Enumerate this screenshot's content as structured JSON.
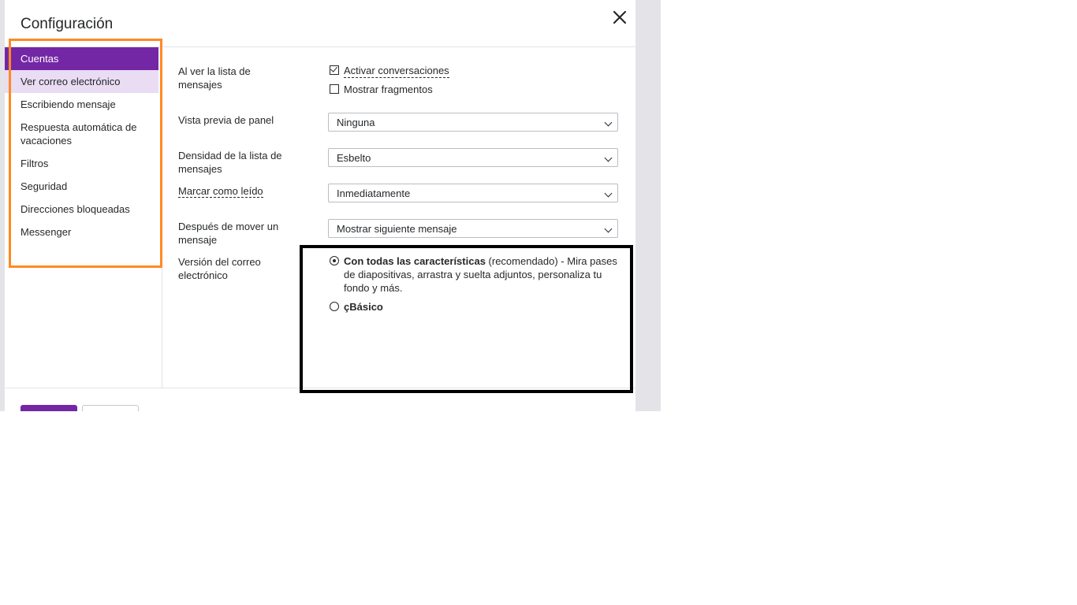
{
  "dialog": {
    "title": "Configuración"
  },
  "sidebar": {
    "items": [
      {
        "label": "Cuentas",
        "state": "active"
      },
      {
        "label": "Ver correo electrónico",
        "state": "hover"
      },
      {
        "label": "Escribiendo mensaje",
        "state": ""
      },
      {
        "label": "Respuesta automática de vacaciones",
        "state": ""
      },
      {
        "label": "Filtros",
        "state": ""
      },
      {
        "label": "Seguridad",
        "state": ""
      },
      {
        "label": "Direcciones bloqueadas",
        "state": ""
      },
      {
        "label": "Messenger",
        "state": ""
      }
    ]
  },
  "settings": {
    "message_list": {
      "label": "Al ver la lista de mensajes",
      "conversations": {
        "label": "Activar conversaciones",
        "checked": true
      },
      "snippets": {
        "label": "Mostrar fragmentos",
        "checked": false
      }
    },
    "preview_pane": {
      "label": "Vista previa de panel",
      "value": "Ninguna"
    },
    "density": {
      "label": "Densidad de la lista de mensajes",
      "value": "Esbelto"
    },
    "mark_read": {
      "label": "Marcar como leído",
      "value": "Inmediatamente"
    },
    "after_move": {
      "label": "Después de mover un mensaje",
      "value": "Mostrar siguiente mensaje"
    },
    "mail_version": {
      "label": "Versión del correo electrónico",
      "full": {
        "title": "Con todas las características",
        "description": " (recomendado) - Mira pases de diapositivas, arrastra y suelta adjuntos, personaliza tu fondo y más.",
        "checked": true
      },
      "basic": {
        "title": "çBásico",
        "checked": false
      }
    }
  },
  "colors": {
    "accent": "#7427a5",
    "sidebar_hover": "#e9dcf3",
    "annotation_orange": "#ff8a24",
    "annotation_black": "#000000"
  },
  "icons": {
    "close": "close-icon",
    "dropdown": "chevron-down-icon"
  }
}
